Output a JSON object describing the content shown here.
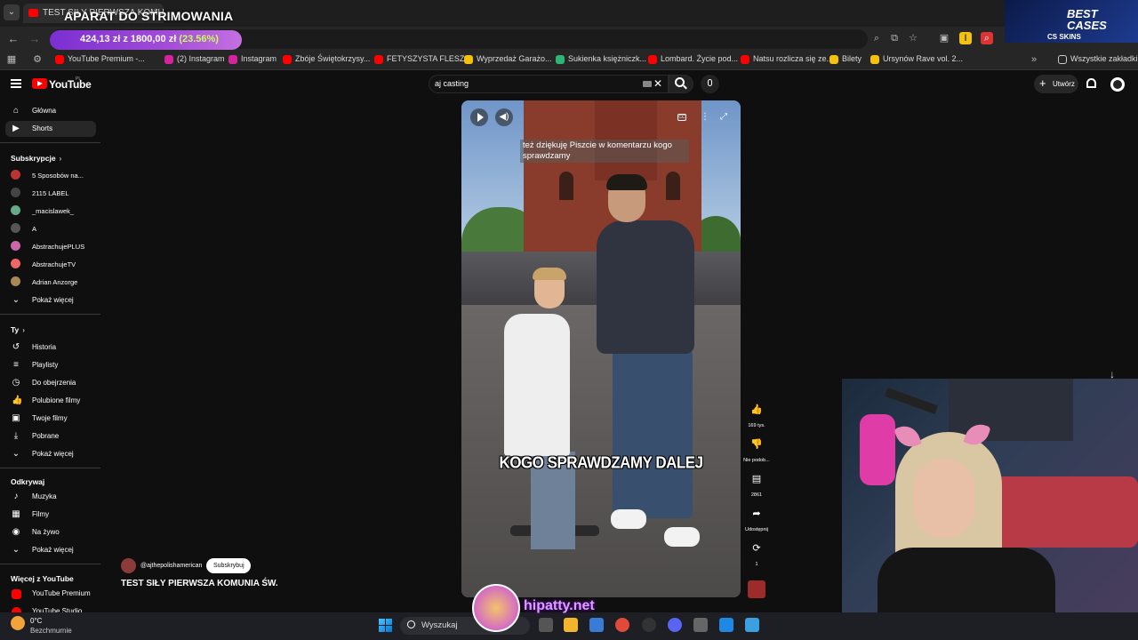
{
  "browser": {
    "tab_title": "TEST SIŁY PIERWSZA KOMUNI",
    "tab_close": "×",
    "overlay_title": "APARAT DO STRIMOWANIA",
    "donation_amount": "424,13 zł z 1800,00 zł",
    "donation_percent": "(23.56%)",
    "bookmarks": [
      {
        "label": "YouTube Premium -...",
        "color": "#ff0000"
      },
      {
        "label": "(2) Instagram",
        "color": "#d6249f"
      },
      {
        "label": "Instagram",
        "color": "#d6249f"
      },
      {
        "label": "Zbóje Świętokrzysy...",
        "color": "#ff0000"
      },
      {
        "label": "FETYSZYSTA FLESZ...",
        "color": "#ff0000"
      },
      {
        "label": "Wyprzedaż Garażo...",
        "color": "#f4c20d"
      },
      {
        "label": "Sukienka księżniczk...",
        "color": "#2bb673"
      },
      {
        "label": "Lombard. Życie pod...",
        "color": "#ff0000"
      },
      {
        "label": "Natsu rozlicza się ze...",
        "color": "#ff0000"
      },
      {
        "label": "Bilety",
        "color": "#f4c20d"
      },
      {
        "label": "Ursynów Rave vol. 2...",
        "color": "#f4c20d"
      }
    ],
    "all_bookmarks": "Wszystkie zakładki",
    "best_cases_title": "BEST CASES",
    "best_cases_sub": "CS SKINS"
  },
  "youtube": {
    "logo_text": "YouTube",
    "region": "PL",
    "search_query": "aj casting",
    "create_label": "Utwórz"
  },
  "sidebar": {
    "main": [
      {
        "label": "Główna",
        "icon": "⌂"
      },
      {
        "label": "Shorts",
        "icon": "▶"
      }
    ],
    "subs_heading": "Subskrypcje",
    "subscriptions": [
      {
        "label": "5 Sposobów na...",
        "color": "#b33"
      },
      {
        "label": "2115 LABEL",
        "color": "#444"
      },
      {
        "label": "_macislawek_",
        "color": "#6a8"
      },
      {
        "label": "A",
        "color": "#555"
      },
      {
        "label": "AbstrachujePLUS",
        "color": "#c6a"
      },
      {
        "label": "AbstrachujeTV",
        "color": "#e66"
      },
      {
        "label": "Adrian Anzorge",
        "color": "#a85"
      }
    ],
    "subs_more": "Pokaż więcej",
    "you_heading": "Ty",
    "you_items": [
      {
        "label": "Historia",
        "icon": "↺"
      },
      {
        "label": "Playlisty",
        "icon": "≡"
      },
      {
        "label": "Do obejrzenia",
        "icon": "◷"
      },
      {
        "label": "Polubione filmy",
        "icon": "👍"
      },
      {
        "label": "Twoje filmy",
        "icon": "▣"
      },
      {
        "label": "Pobrane",
        "icon": "⤓"
      }
    ],
    "you_more": "Pokaż więcej",
    "explore_heading": "Odkrywaj",
    "explore_items": [
      {
        "label": "Muzyka",
        "icon": "♪"
      },
      {
        "label": "Filmy",
        "icon": "▦"
      },
      {
        "label": "Na żywo",
        "icon": "◉"
      }
    ],
    "explore_more": "Pokaż więcej",
    "more_heading": "Więcej z YouTube",
    "more_items": [
      {
        "label": "YouTube Premium",
        "color": "#ff0000"
      },
      {
        "label": "YouTube Studio",
        "color": "#ff0000"
      }
    ]
  },
  "video": {
    "comment_overlay": "też dziękuję Piszcie w komentarzu kogo sprawdzamy",
    "caption": "KOGO SPRAWDZAMY DALEJ",
    "channel": "@ajthepolishamerican",
    "subscribe": "Subskrybuj",
    "title": "TEST SIŁY PIERWSZA KOMUNIA ŚW."
  },
  "actions": {
    "likes": "169 tys.",
    "dislike": "Nie podob...",
    "comments": "2861",
    "share": "Udostępnij",
    "remix": "1"
  },
  "overlay": {
    "hipatty": "hipatty.net"
  },
  "taskbar": {
    "temp": "0°C",
    "weather": "Bezchmurnie",
    "search": "Wyszukaj"
  }
}
